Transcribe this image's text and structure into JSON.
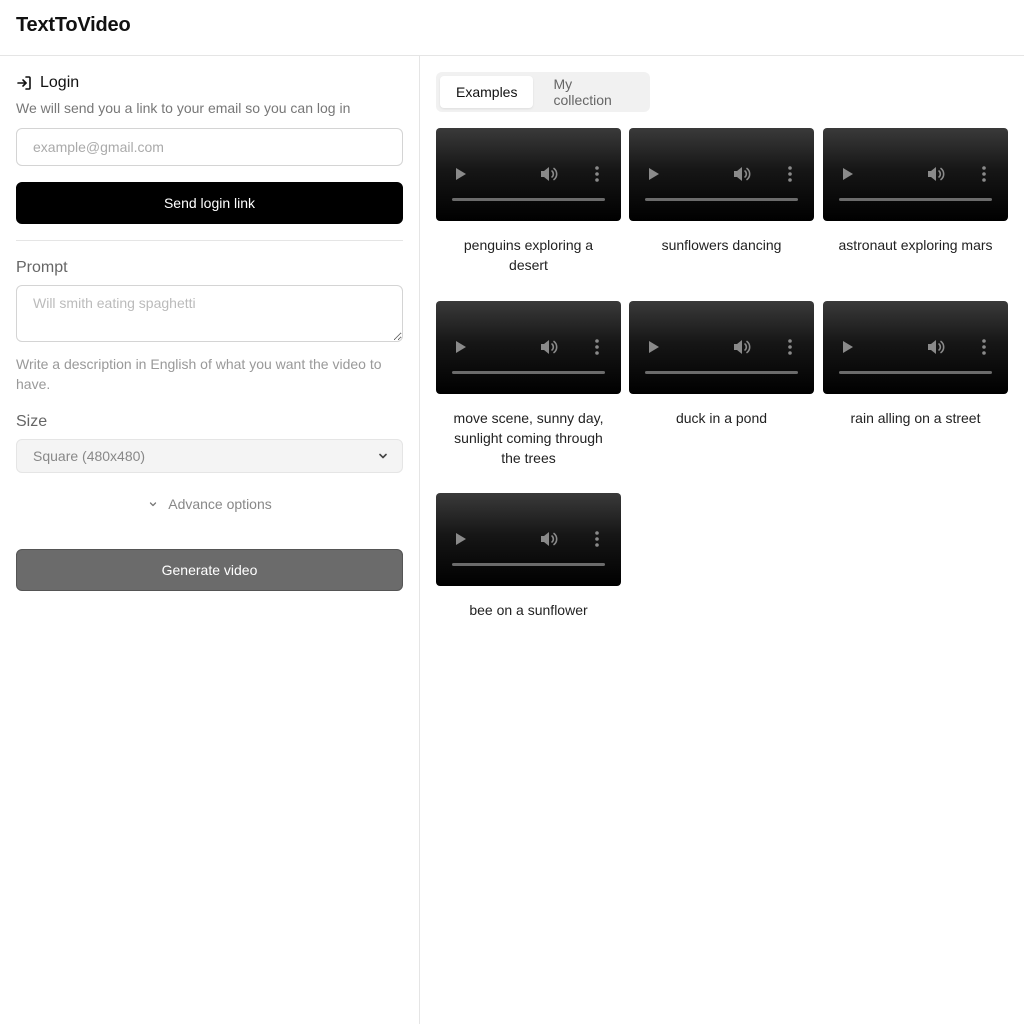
{
  "app": {
    "title": "TextToVideo"
  },
  "login": {
    "icon": "login-icon",
    "title": "Login",
    "description": "We will send you a link to your email so you can log in",
    "email_placeholder": "example@gmail.com",
    "email_value": "",
    "send_label": "Send login link"
  },
  "form": {
    "prompt_label": "Prompt",
    "prompt_placeholder": "Will smith eating spaghetti",
    "prompt_value": "",
    "prompt_help": "Write a description in English of what you want the video to have.",
    "size_label": "Size",
    "size_value": "Square (480x480)",
    "advance_label": "Advance options",
    "generate_label": "Generate video"
  },
  "tabs": [
    {
      "label": "Examples",
      "active": true
    },
    {
      "label": "My collection",
      "active": false
    }
  ],
  "examples": [
    {
      "caption": "penguins exploring a desert"
    },
    {
      "caption": "sunflowers dancing"
    },
    {
      "caption": "astronaut exploring mars"
    },
    {
      "caption": "move scene, sunny day, sunlight coming through the trees"
    },
    {
      "caption": "duck in a pond"
    },
    {
      "caption": "rain alling on a street"
    },
    {
      "caption": "bee on a sunflower"
    }
  ],
  "colors": {
    "primary_button": "#000000",
    "generate_button": "#6b6b6b",
    "border": "#e5e5e5"
  }
}
